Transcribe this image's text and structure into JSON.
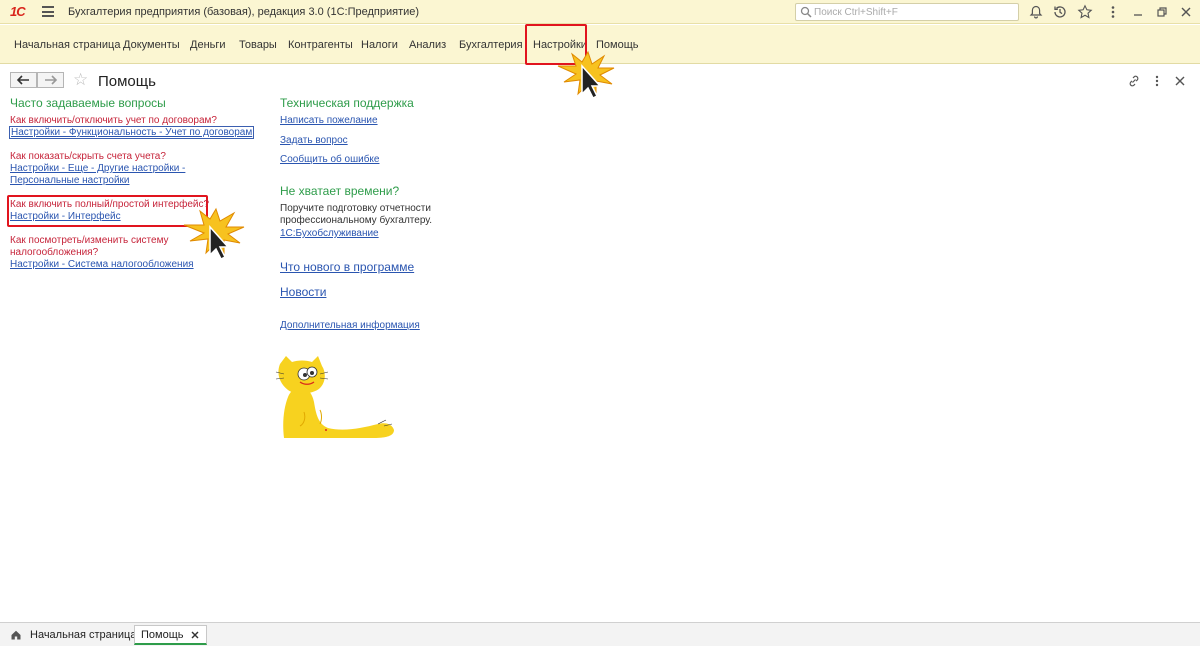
{
  "app": {
    "logo_text": "1С",
    "title": "Бухгалтерия предприятия (базовая), редакция 3.0  (1С:Предприятие)",
    "search_placeholder": "Поиск Ctrl+Shift+F"
  },
  "menu": {
    "items": [
      "Начальная страница",
      "Документы",
      "Деньги",
      "Товары",
      "Контрагенты",
      "Налоги",
      "Анализ",
      "Бухгалтерия",
      "Настройки",
      "Помощь"
    ],
    "highlighted": "Настройки"
  },
  "page": {
    "title": "Помощь"
  },
  "faq": {
    "heading": "Часто задаваемые вопросы",
    "q1": "Как включить/отключить учет по договорам?",
    "q1_link": "Настройки - Функциональность - Учет по договорам",
    "q2": "Как показать/скрыть счета учета?",
    "q2_link_line1": "Настройки - Еще - Другие настройки -",
    "q2_link_line2": "Персональные настройки",
    "q3": "Как включить полный/простой интерфейс?",
    "q3_link": "Настройки - Интерфейс",
    "q4_line1": "Как посмотреть/изменить систему",
    "q4_line2": "налогообложения?",
    "q4_link": "Настройки - Система налогообложения"
  },
  "support": {
    "heading": "Техническая поддержка",
    "links": [
      "Написать пожелание",
      "Задать вопрос",
      "Сообщить об ошибке"
    ]
  },
  "no_time": {
    "heading": "Не хватает времени?",
    "line1": "Поручите подготовку отчетности",
    "line2": "профессиональному бухгалтеру.",
    "link": "1С:Бухобслуживание"
  },
  "extra": {
    "whats_new": "Что нового в программе",
    "news": "Новости",
    "more_info": "Дополнительная информация"
  },
  "tabs": [
    {
      "label": "Начальная страница",
      "active": false
    },
    {
      "label": "Помощь",
      "active": true
    }
  ],
  "colors": {
    "bar_bg": "#fbf6d2",
    "heading_green": "#2e9c4a",
    "question_red": "#c6243a",
    "link_blue": "#2a55b0",
    "highlight_red": "#e1141e",
    "cat_yellow": "#f7d21f"
  }
}
